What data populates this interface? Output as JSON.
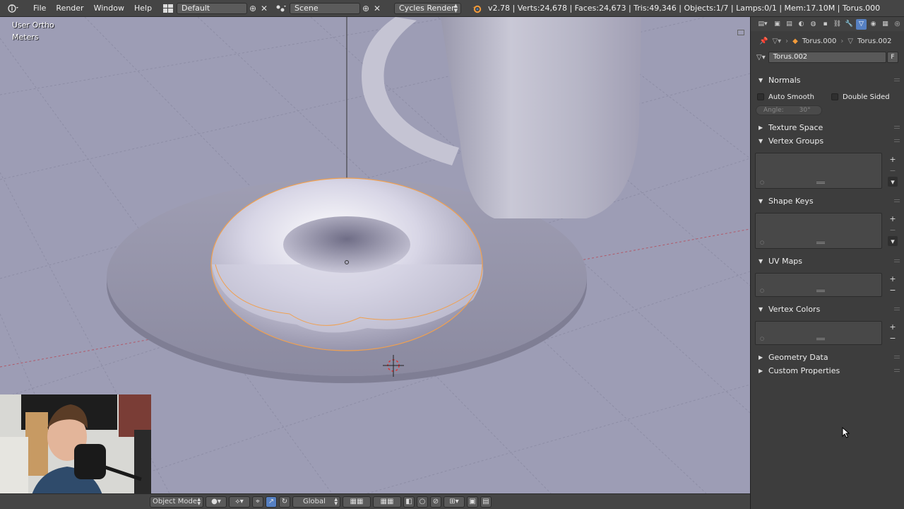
{
  "menu": {
    "items": [
      "File",
      "Render",
      "Window",
      "Help"
    ]
  },
  "layout": {
    "value": "Default"
  },
  "scene": {
    "value": "Scene"
  },
  "engine": {
    "value": "Cycles Render"
  },
  "stats": "v2.78 | Verts:24,678 | Faces:24,673 | Tris:49,346 | Objects:1/7 | Lamps:0/1 | Mem:17.10M | Torus.000",
  "viewport": {
    "view_name": "User Ortho",
    "units": "Meters"
  },
  "vheader": {
    "mode": "Object Mode",
    "orientation": "Global"
  },
  "props": {
    "breadcrumb": [
      "Torus.000",
      "Torus.002"
    ],
    "mesh_name": "Torus.002",
    "fake_user": "F",
    "panels": {
      "normals": "Normals",
      "auto_smooth": "Auto Smooth",
      "double_sided": "Double Sided",
      "angle": "Angle:",
      "angle_value": "30°",
      "texture_space": "Texture Space",
      "vertex_groups": "Vertex Groups",
      "shape_keys": "Shape Keys",
      "uv_maps": "UV Maps",
      "vertex_colors": "Vertex Colors",
      "geometry_data": "Geometry Data",
      "custom_properties": "Custom Properties"
    }
  },
  "colors": {
    "viewport_bg": "#9d9db5",
    "selection_outline": "#f0a050",
    "active_tab": "#5680c2",
    "panel_bg": "#3d3d3d"
  }
}
